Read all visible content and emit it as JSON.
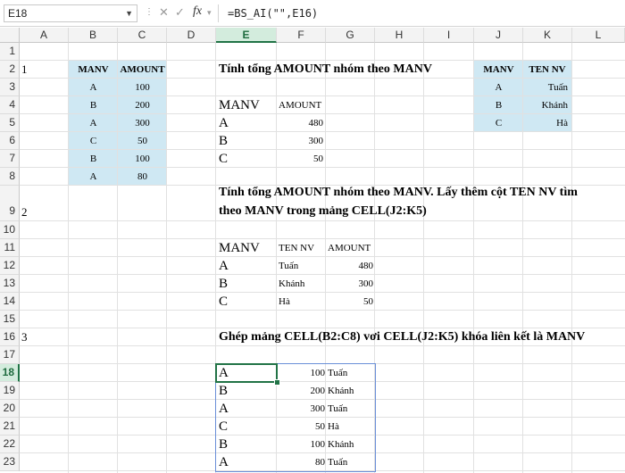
{
  "formula_bar": {
    "name_box": "E18",
    "formula": "=BS_AI(\"\",E16)"
  },
  "columns": [
    "A",
    "B",
    "C",
    "D",
    "E",
    "F",
    "G",
    "H",
    "I",
    "J",
    "K",
    "L"
  ],
  "selected_column": "E",
  "rows": [
    "1",
    "2",
    "3",
    "4",
    "5",
    "6",
    "7",
    "8",
    "9",
    "10",
    "11",
    "12",
    "13",
    "14",
    "15",
    "16",
    "17",
    "18",
    "19",
    "20",
    "21",
    "22",
    "23"
  ],
  "selected_row": "18",
  "cells": {
    "A2": "1",
    "A9": "2",
    "A16": "3",
    "B2": "MANV",
    "C2": "AMOUNT",
    "B3": "A",
    "C3": "100",
    "B4": "B",
    "C4": "200",
    "B5": "A",
    "C5": "300",
    "B6": "C",
    "C6": "50",
    "B7": "B",
    "C7": "100",
    "B8": "A",
    "C8": "80",
    "E2": "Tính tổng AMOUNT nhóm theo MANV",
    "E4": "MANV",
    "F4": "AMOUNT",
    "E5": "A",
    "F5": "480",
    "E6": "B",
    "F6": "300",
    "E7": "C",
    "F7": "50",
    "J2": "MANV",
    "K2": "TEN NV",
    "J3": "A",
    "K3": "Tuấn",
    "J4": "B",
    "K4": "Khánh",
    "J5": "C",
    "K5": "Hà",
    "E9a": "Tính tổng AMOUNT nhóm theo MANV. Lấy thêm cột TEN NV tìm",
    "E9b": "theo MANV trong mảng CELL(J2:K5)",
    "E11": "MANV",
    "F11": "TEN NV",
    "G11": "AMOUNT",
    "E12": "A",
    "F12": "Tuấn",
    "G12": "480",
    "E13": "B",
    "F13": "Khánh",
    "G13": "300",
    "E14": "C",
    "F14": "Hà",
    "G14": "50",
    "E16": "Ghép mảng CELL(B2:C8)  vơi CELL(J2:K5)  khóa liên kết là MANV",
    "E18": "A",
    "F18": "100",
    "G18": "Tuấn",
    "E19": "B",
    "F19": "200",
    "G19": "Khánh",
    "E20": "A",
    "F20": "300",
    "G20": "Tuấn",
    "E21": "C",
    "F21": "50",
    "G21": "Hà",
    "E22": "B",
    "F22": "100",
    "G22": "Khánh",
    "E23": "A",
    "F23": "80",
    "G23": "Tuấn"
  },
  "colors": {
    "table_fill": "#cfe8f3",
    "selection": "#217346",
    "spill_border": "#6a8fd8"
  }
}
